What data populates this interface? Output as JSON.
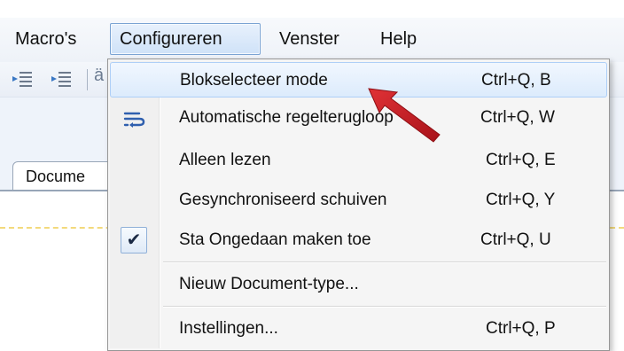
{
  "menubar": {
    "items": [
      {
        "label": "Macro's"
      },
      {
        "label": "Configureren"
      },
      {
        "label": "Venster"
      },
      {
        "label": "Help"
      }
    ]
  },
  "tabs": {
    "document_tab": "Docume"
  },
  "toolbar": {
    "partial_glyph": "ä"
  },
  "dropdown": {
    "items": [
      {
        "label": "Blokselecteer mode",
        "shortcut": "Ctrl+Q, B",
        "highlighted": true
      },
      {
        "label": "Automatische regelterugloop",
        "shortcut": "Ctrl+Q, W",
        "icon": "word-wrap-icon"
      },
      {
        "label": "Alleen lezen",
        "shortcut": "Ctrl+Q, E"
      },
      {
        "label": "Gesynchroniseerd schuiven",
        "shortcut": "Ctrl+Q, Y"
      },
      {
        "label": "Sta Ongedaan maken toe",
        "shortcut": "Ctrl+Q, U",
        "checked": true,
        "check_glyph": "✔"
      },
      {
        "label": "Nieuw Document-type..."
      },
      {
        "label": "Instellingen...",
        "shortcut": "Ctrl+Q, P"
      }
    ]
  },
  "colors": {
    "highlight": "#dcebfc",
    "menu_open": "#cfe2f8",
    "annotation_arrow": "#c0171c",
    "dashed_line": "#f3da7c"
  }
}
